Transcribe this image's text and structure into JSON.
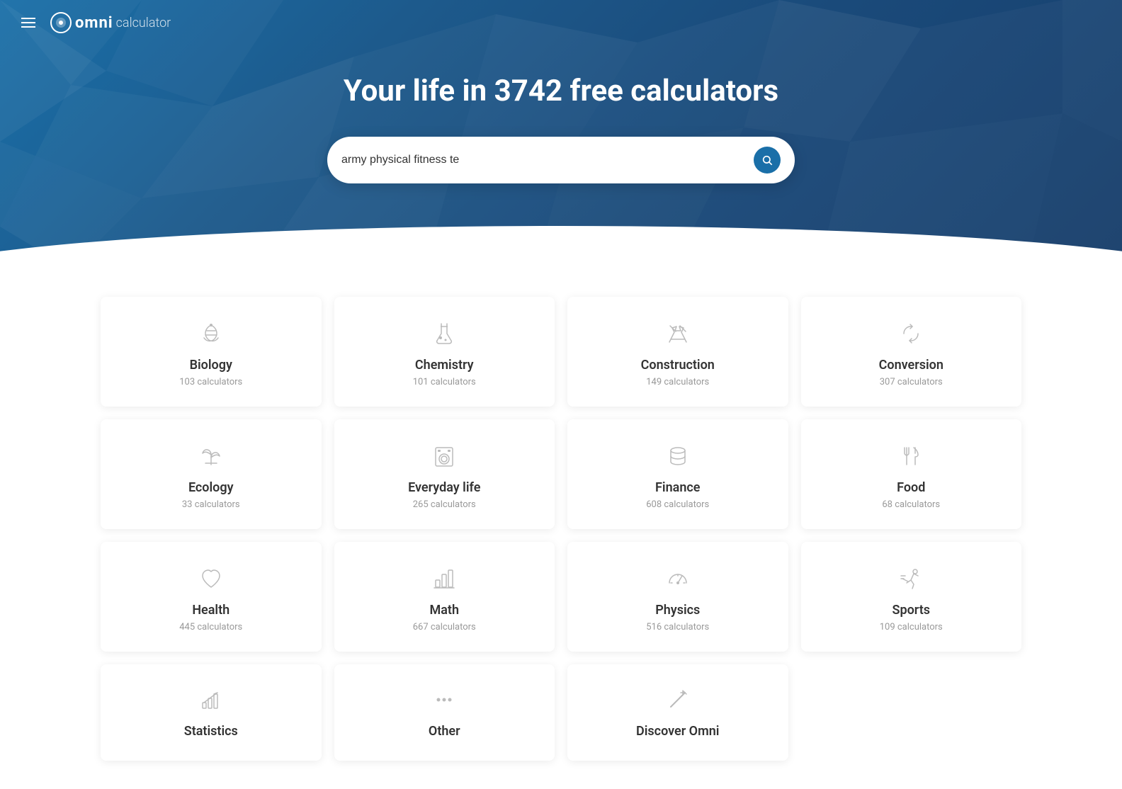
{
  "hero": {
    "title": "Your life in 3742 free calculators",
    "search": {
      "placeholder": "army physical fitness te",
      "value": "army physical fitness te"
    }
  },
  "nav": {
    "logo_omni": "omni",
    "logo_calc": "calculator"
  },
  "categories": [
    {
      "name": "Biology",
      "count": "103 calculators",
      "icon": "biology"
    },
    {
      "name": "Chemistry",
      "count": "101 calculators",
      "icon": "chemistry"
    },
    {
      "name": "Construction",
      "count": "149 calculators",
      "icon": "construction"
    },
    {
      "name": "Conversion",
      "count": "307 calculators",
      "icon": "conversion"
    },
    {
      "name": "Ecology",
      "count": "33 calculators",
      "icon": "ecology"
    },
    {
      "name": "Everyday life",
      "count": "265 calculators",
      "icon": "everyday"
    },
    {
      "name": "Finance",
      "count": "608 calculators",
      "icon": "finance"
    },
    {
      "name": "Food",
      "count": "68 calculators",
      "icon": "food"
    },
    {
      "name": "Health",
      "count": "445 calculators",
      "icon": "health"
    },
    {
      "name": "Math",
      "count": "667 calculators",
      "icon": "math"
    },
    {
      "name": "Physics",
      "count": "516 calculators",
      "icon": "physics"
    },
    {
      "name": "Sports",
      "count": "109 calculators",
      "icon": "sports"
    },
    {
      "name": "Statistics",
      "count": "",
      "icon": "statistics"
    },
    {
      "name": "Other",
      "count": "",
      "icon": "other"
    },
    {
      "name": "Discover Omni",
      "count": "",
      "icon": "discover"
    }
  ]
}
